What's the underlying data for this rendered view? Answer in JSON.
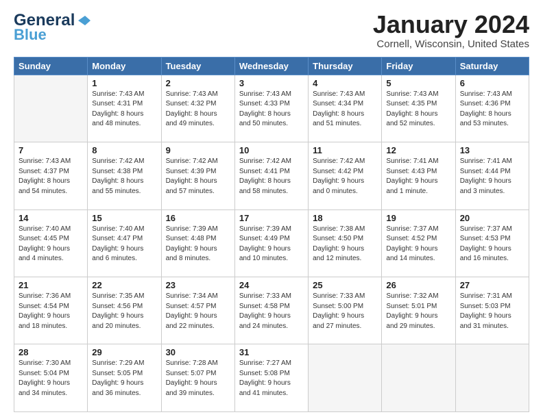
{
  "header": {
    "logo_general": "General",
    "logo_blue": "Blue",
    "title": "January 2024",
    "subtitle": "Cornell, Wisconsin, United States"
  },
  "weekdays": [
    "Sunday",
    "Monday",
    "Tuesday",
    "Wednesday",
    "Thursday",
    "Friday",
    "Saturday"
  ],
  "weeks": [
    [
      {
        "day": "",
        "info": ""
      },
      {
        "day": "1",
        "info": "Sunrise: 7:43 AM\nSunset: 4:31 PM\nDaylight: 8 hours\nand 48 minutes."
      },
      {
        "day": "2",
        "info": "Sunrise: 7:43 AM\nSunset: 4:32 PM\nDaylight: 8 hours\nand 49 minutes."
      },
      {
        "day": "3",
        "info": "Sunrise: 7:43 AM\nSunset: 4:33 PM\nDaylight: 8 hours\nand 50 minutes."
      },
      {
        "day": "4",
        "info": "Sunrise: 7:43 AM\nSunset: 4:34 PM\nDaylight: 8 hours\nand 51 minutes."
      },
      {
        "day": "5",
        "info": "Sunrise: 7:43 AM\nSunset: 4:35 PM\nDaylight: 8 hours\nand 52 minutes."
      },
      {
        "day": "6",
        "info": "Sunrise: 7:43 AM\nSunset: 4:36 PM\nDaylight: 8 hours\nand 53 minutes."
      }
    ],
    [
      {
        "day": "7",
        "info": "Sunrise: 7:43 AM\nSunset: 4:37 PM\nDaylight: 8 hours\nand 54 minutes."
      },
      {
        "day": "8",
        "info": "Sunrise: 7:42 AM\nSunset: 4:38 PM\nDaylight: 8 hours\nand 55 minutes."
      },
      {
        "day": "9",
        "info": "Sunrise: 7:42 AM\nSunset: 4:39 PM\nDaylight: 8 hours\nand 57 minutes."
      },
      {
        "day": "10",
        "info": "Sunrise: 7:42 AM\nSunset: 4:41 PM\nDaylight: 8 hours\nand 58 minutes."
      },
      {
        "day": "11",
        "info": "Sunrise: 7:42 AM\nSunset: 4:42 PM\nDaylight: 9 hours\nand 0 minutes."
      },
      {
        "day": "12",
        "info": "Sunrise: 7:41 AM\nSunset: 4:43 PM\nDaylight: 9 hours\nand 1 minute."
      },
      {
        "day": "13",
        "info": "Sunrise: 7:41 AM\nSunset: 4:44 PM\nDaylight: 9 hours\nand 3 minutes."
      }
    ],
    [
      {
        "day": "14",
        "info": "Sunrise: 7:40 AM\nSunset: 4:45 PM\nDaylight: 9 hours\nand 4 minutes."
      },
      {
        "day": "15",
        "info": "Sunrise: 7:40 AM\nSunset: 4:47 PM\nDaylight: 9 hours\nand 6 minutes."
      },
      {
        "day": "16",
        "info": "Sunrise: 7:39 AM\nSunset: 4:48 PM\nDaylight: 9 hours\nand 8 minutes."
      },
      {
        "day": "17",
        "info": "Sunrise: 7:39 AM\nSunset: 4:49 PM\nDaylight: 9 hours\nand 10 minutes."
      },
      {
        "day": "18",
        "info": "Sunrise: 7:38 AM\nSunset: 4:50 PM\nDaylight: 9 hours\nand 12 minutes."
      },
      {
        "day": "19",
        "info": "Sunrise: 7:37 AM\nSunset: 4:52 PM\nDaylight: 9 hours\nand 14 minutes."
      },
      {
        "day": "20",
        "info": "Sunrise: 7:37 AM\nSunset: 4:53 PM\nDaylight: 9 hours\nand 16 minutes."
      }
    ],
    [
      {
        "day": "21",
        "info": "Sunrise: 7:36 AM\nSunset: 4:54 PM\nDaylight: 9 hours\nand 18 minutes."
      },
      {
        "day": "22",
        "info": "Sunrise: 7:35 AM\nSunset: 4:56 PM\nDaylight: 9 hours\nand 20 minutes."
      },
      {
        "day": "23",
        "info": "Sunrise: 7:34 AM\nSunset: 4:57 PM\nDaylight: 9 hours\nand 22 minutes."
      },
      {
        "day": "24",
        "info": "Sunrise: 7:33 AM\nSunset: 4:58 PM\nDaylight: 9 hours\nand 24 minutes."
      },
      {
        "day": "25",
        "info": "Sunrise: 7:33 AM\nSunset: 5:00 PM\nDaylight: 9 hours\nand 27 minutes."
      },
      {
        "day": "26",
        "info": "Sunrise: 7:32 AM\nSunset: 5:01 PM\nDaylight: 9 hours\nand 29 minutes."
      },
      {
        "day": "27",
        "info": "Sunrise: 7:31 AM\nSunset: 5:03 PM\nDaylight: 9 hours\nand 31 minutes."
      }
    ],
    [
      {
        "day": "28",
        "info": "Sunrise: 7:30 AM\nSunset: 5:04 PM\nDaylight: 9 hours\nand 34 minutes."
      },
      {
        "day": "29",
        "info": "Sunrise: 7:29 AM\nSunset: 5:05 PM\nDaylight: 9 hours\nand 36 minutes."
      },
      {
        "day": "30",
        "info": "Sunrise: 7:28 AM\nSunset: 5:07 PM\nDaylight: 9 hours\nand 39 minutes."
      },
      {
        "day": "31",
        "info": "Sunrise: 7:27 AM\nSunset: 5:08 PM\nDaylight: 9 hours\nand 41 minutes."
      },
      {
        "day": "",
        "info": ""
      },
      {
        "day": "",
        "info": ""
      },
      {
        "day": "",
        "info": ""
      }
    ]
  ]
}
